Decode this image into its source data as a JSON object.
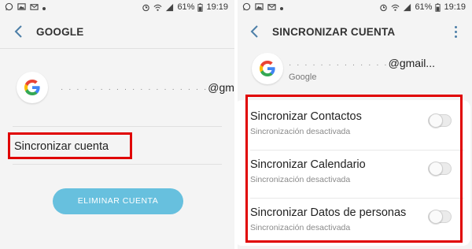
{
  "status_bar": {
    "battery": "61%",
    "time": "19:19",
    "left_icons": [
      "whatsapp-icon",
      "gallery-icon",
      "email-icon",
      "dot-icon"
    ],
    "right_icons": [
      "alarm-icon",
      "wifi-icon",
      "signal-icon",
      "battery-icon"
    ]
  },
  "left_screen": {
    "title": "GOOGLE",
    "account": {
      "email_mask": "· · · · · · · · · · · · · · · · · · ·",
      "email_domain": "@gmail.com"
    },
    "sync_label": "Sincronizar cuenta",
    "delete_button": "ELIMINAR CUENTA"
  },
  "right_screen": {
    "title": "SINCRONIZAR CUENTA",
    "account": {
      "email_mask": "· · · · · · · · · · · · ·",
      "email_domain": "@gmail...",
      "provider": "Google"
    },
    "sync_items": [
      {
        "title": "Sincronizar Contactos",
        "status": "Sincronización desactivada",
        "enabled": false
      },
      {
        "title": "Sincronizar Calendario",
        "status": "Sincronización desactivada",
        "enabled": false
      },
      {
        "title": "Sincronizar Datos de personas",
        "status": "Sincronización desactivada",
        "enabled": false
      }
    ]
  },
  "colors": {
    "accent": "#4d7fa8",
    "highlight": "#e00000",
    "button": "#67c0de"
  }
}
